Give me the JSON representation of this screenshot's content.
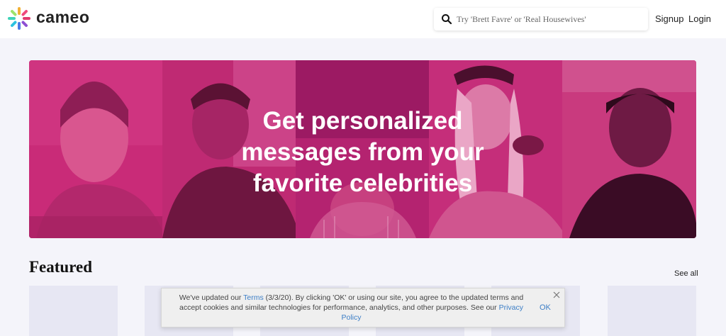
{
  "header": {
    "logo_text": "cameo",
    "search": {
      "placeholder": "Try 'Brett Favre' or 'Real Housewives'",
      "icon": "search-icon"
    },
    "signup_label": "Signup",
    "login_label": "Login"
  },
  "hero": {
    "title_lines": [
      "Get personalized",
      "messages from your",
      "favorite celebrities"
    ],
    "overlay_color": "#c2246e"
  },
  "featured": {
    "title": "Featured",
    "see_all_label": "See all"
  },
  "cookie_banner": {
    "text_before_terms": "We've updated our ",
    "terms_link": "Terms",
    "text_after_terms": " (3/3/20). By clicking 'OK' or using our site, you agree to the updated terms and accept cookies and similar technologies for performance, analytics, and other purposes. See our ",
    "privacy_link": "Privacy Policy",
    "ok_label": "OK",
    "close_icon": "close-icon"
  }
}
